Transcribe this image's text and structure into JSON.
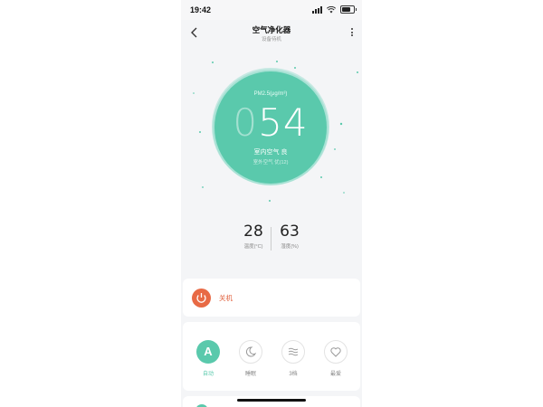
{
  "status_bar": {
    "time": "19:42"
  },
  "header": {
    "title": "空气净化器",
    "subtitle": "设备待机"
  },
  "reading": {
    "pm_label": "PM2.5(μg/m³)",
    "value_dim": "0",
    "value_main": "54",
    "indoor_label": "室内空气 良",
    "outdoor_label": "室外空气 优(12)"
  },
  "stats": {
    "temperature": {
      "value": "28",
      "label": "温度(°C)"
    },
    "humidity": {
      "value": "63",
      "label": "湿度(%)"
    }
  },
  "power": {
    "label": "关机"
  },
  "modes": [
    {
      "label": "自动",
      "glyph": "A",
      "icon": "auto-icon",
      "active": true
    },
    {
      "label": "睡眠",
      "icon": "moon-icon",
      "active": false
    },
    {
      "label": "3档",
      "icon": "wind-icon",
      "active": false
    },
    {
      "label": "最爱",
      "icon": "heart-icon",
      "active": false
    }
  ],
  "colors": {
    "accent": "#5ac9ac",
    "power": "#e86a45",
    "background": "#f4f5f7"
  }
}
